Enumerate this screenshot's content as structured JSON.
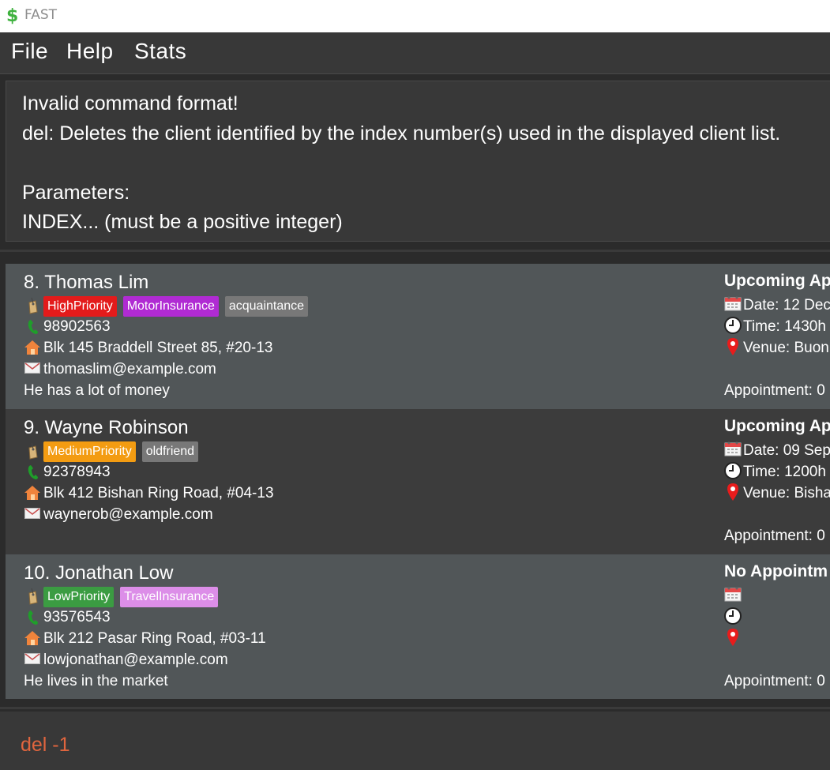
{
  "window": {
    "title": "FAST"
  },
  "menu": {
    "file": "File",
    "help": "Help",
    "stats": "Stats"
  },
  "result": {
    "lines": [
      "Invalid command format!",
      "del: Deletes the client identified by the index number(s) used in the displayed client list.",
      "Parameters:",
      "INDEX... (must be a positive integer)"
    ]
  },
  "clients": [
    {
      "name": "8.  Thomas Lim",
      "tags": [
        {
          "label": "HighPriority",
          "color": "#e31b1b"
        },
        {
          "label": "MotorInsurance",
          "color": "#b02bd3"
        },
        {
          "label": "acquaintance",
          "color": "#787878"
        }
      ],
      "phone": "98902563",
      "address": "Blk 145 Braddell Street 85, #20-13",
      "email": "thomaslim@example.com",
      "remark": "He has a lot of money",
      "appointment": {
        "title": "Upcoming Ap",
        "date": "Date: 12 Dec",
        "time": "Time: 1430h",
        "venue": "Venue: Buon",
        "count": "Appointment: 0"
      }
    },
    {
      "name": "9.  Wayne Robinson",
      "tags": [
        {
          "label": "MediumPriority",
          "color": "#f39c12"
        },
        {
          "label": "oldfriend",
          "color": "#787878"
        }
      ],
      "phone": "92378943",
      "address": "Blk 412 Bishan Ring Road, #04-13",
      "email": "waynerob@example.com",
      "remark": "",
      "appointment": {
        "title": "Upcoming Ap",
        "date": "Date: 09 Sep",
        "time": "Time: 1200h",
        "venue": "Venue: Bisha",
        "count": "Appointment: 0"
      }
    },
    {
      "name": "10.  Jonathan Low",
      "tags": [
        {
          "label": "LowPriority",
          "color": "#3b9c42"
        },
        {
          "label": "TravelInsurance",
          "color": "#dc8ee8"
        }
      ],
      "phone": "93576543",
      "address": "Blk 212 Pasar Ring Road, #03-11",
      "email": "lowjonathan@example.com",
      "remark": "He lives in the market",
      "appointment": {
        "title": "No Appointm",
        "date": "",
        "time": "",
        "venue": "",
        "count": "Appointment: 0"
      }
    }
  ],
  "command": {
    "value": "del -1"
  },
  "icons": {
    "app": "dollar-icon",
    "tag": "tag-icon",
    "phone": "phone-icon",
    "address": "house-icon",
    "email": "envelope-icon",
    "date": "calendar-icon",
    "time": "clock-icon",
    "venue": "location-pin-icon"
  },
  "colors": {
    "background": "#2b2b2b",
    "panel": "#383838",
    "card_light": "#515658",
    "card_dark": "#3c3c3c",
    "command_text": "#e0653e",
    "app_icon": "#3fb23f"
  }
}
